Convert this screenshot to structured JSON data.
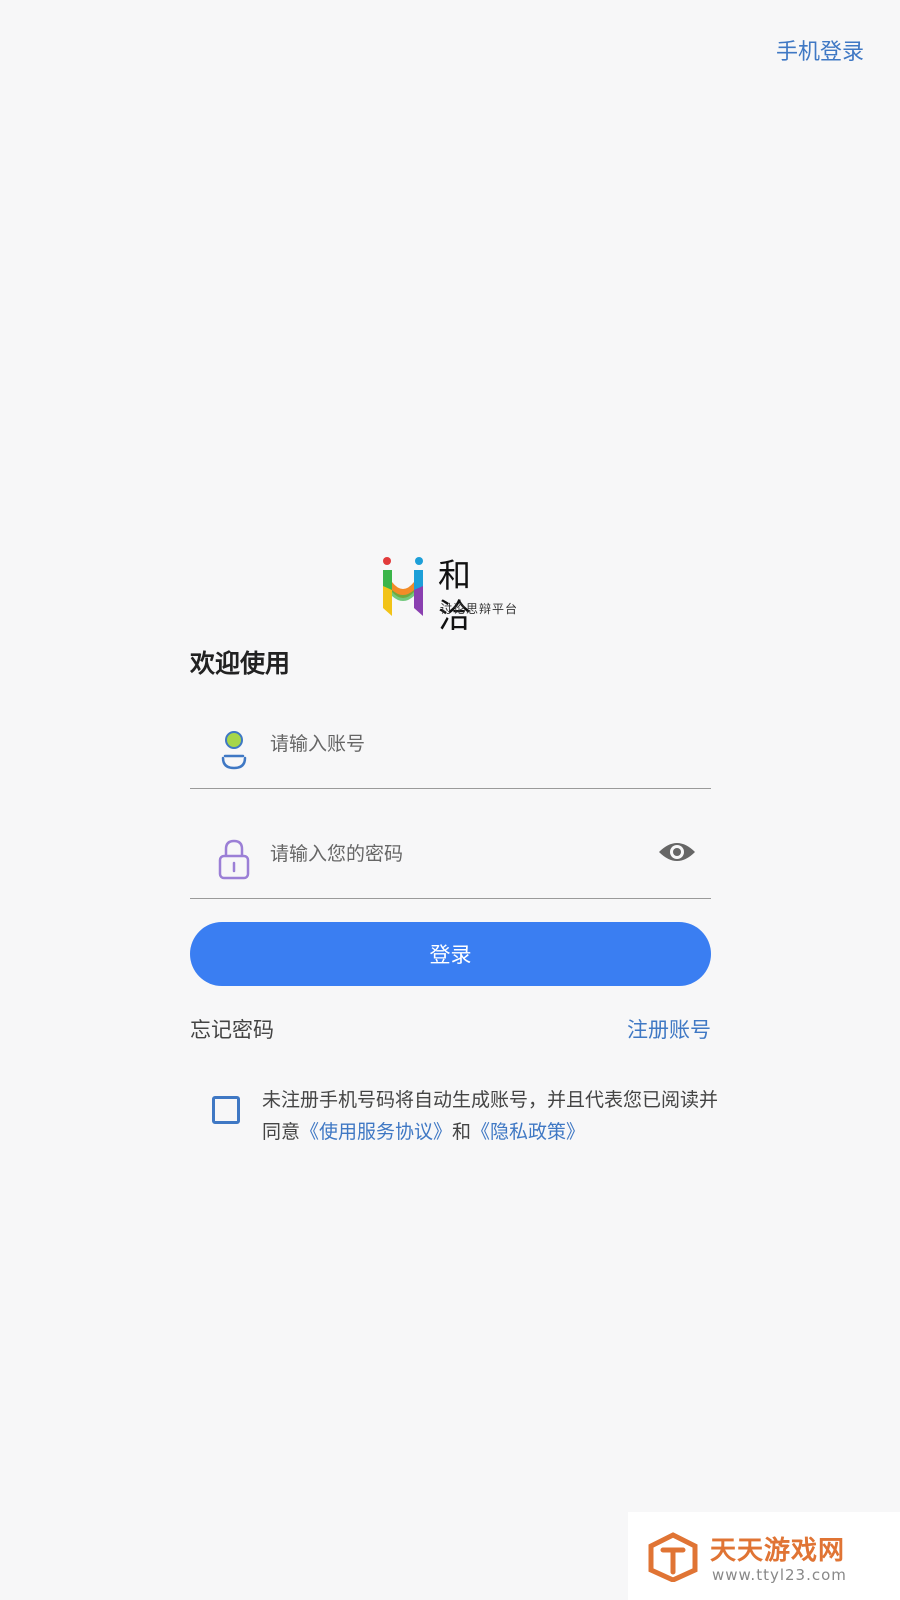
{
  "header": {
    "phone_login_label": "手机登录"
  },
  "logo": {
    "name": "和 洽",
    "subtitle": "讨论思辩平台"
  },
  "welcome": "欢迎使用",
  "account_field": {
    "placeholder": "请输入账号",
    "value": ""
  },
  "password_field": {
    "placeholder": "请输入您的密码",
    "value": ""
  },
  "login_button": "登录",
  "forgot_password": "忘记密码",
  "register": "注册账号",
  "agreement": {
    "checked": false,
    "text_before": "未注册手机号码将自动生成账号，并且代表您已阅读并同意",
    "terms_link": "《使用服务协议》",
    "and": "和",
    "privacy_link": "《隐私政策》"
  },
  "watermark": {
    "title": "天天游戏网",
    "url": "www.ttyl23.com"
  },
  "colors": {
    "accent": "#3a7ef2",
    "link": "#3f78c4",
    "background": "#f7f7f8"
  }
}
